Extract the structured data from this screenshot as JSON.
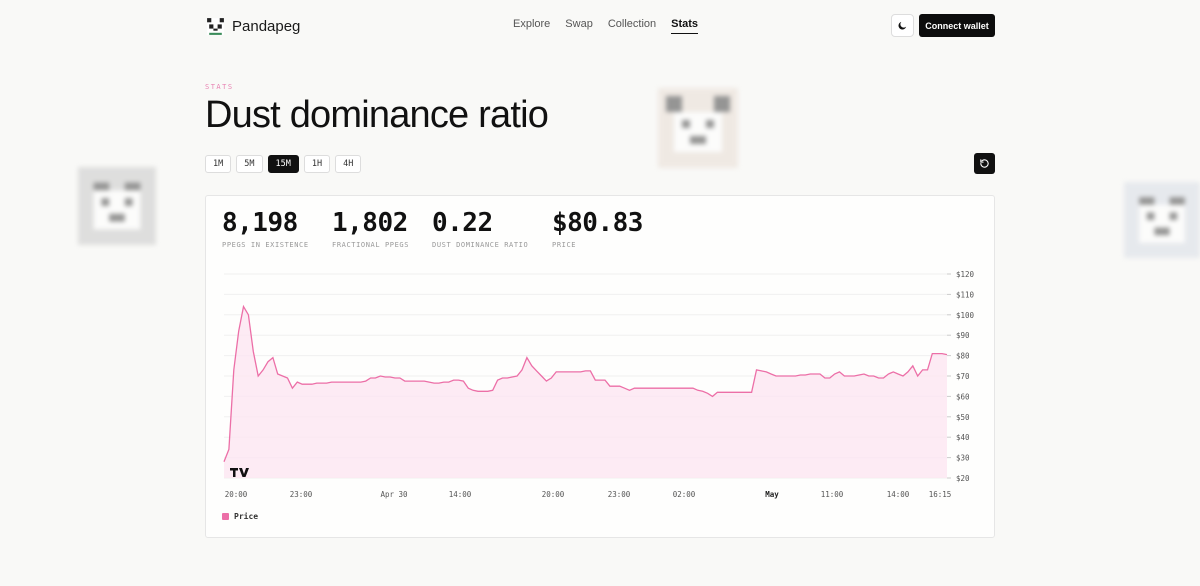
{
  "header": {
    "brand": "Pandapeg",
    "nav": [
      {
        "label": "Explore",
        "active": false
      },
      {
        "label": "Swap",
        "active": false
      },
      {
        "label": "Collection",
        "active": false
      },
      {
        "label": "Stats",
        "active": true
      }
    ],
    "theme_icon": "moon-icon",
    "connect_label": "Connect wallet"
  },
  "page": {
    "eyebrow": "STATS",
    "title": "Dust dominance ratio"
  },
  "timeframes": [
    {
      "label": "1M",
      "active": false
    },
    {
      "label": "5M",
      "active": false
    },
    {
      "label": "15M",
      "active": true
    },
    {
      "label": "1H",
      "active": false
    },
    {
      "label": "4H",
      "active": false
    }
  ],
  "refresh_icon": "refresh-icon",
  "stats": [
    {
      "value": "8,198",
      "label": "PPEGS IN EXISTENCE"
    },
    {
      "value": "1,802",
      "label": "FRACTIONAL PPEGS"
    },
    {
      "value": "0.22",
      "label": "DUST DOMINANCE RATIO"
    },
    {
      "value": "$80.83",
      "label": "PRICE"
    }
  ],
  "legend": {
    "label": "Price"
  },
  "watermark_icon": "tradingview-logo-icon",
  "colors": {
    "accent_pink": "#ec6fa7",
    "area_fill": "#fde6f1",
    "eyebrow": "#e884b3"
  },
  "chart_data": {
    "type": "area",
    "series": [
      {
        "name": "Price",
        "values": [
          28,
          34,
          73,
          92,
          104,
          100,
          82,
          70,
          73,
          77,
          79,
          71,
          70,
          69,
          64,
          67,
          66,
          66,
          66,
          66.5,
          66.5,
          66.5,
          67,
          67,
          67,
          67,
          67,
          67,
          67,
          67.5,
          69,
          69,
          70,
          69.5,
          69.5,
          69,
          69,
          67.5,
          67.5,
          67.5,
          67.5,
          67.5,
          67,
          66.5,
          66.5,
          67,
          67,
          68,
          68,
          67.5,
          64,
          63,
          62.5,
          62.5,
          62.5,
          63,
          68,
          69,
          69,
          69.5,
          70,
          73,
          79,
          75,
          72.5,
          70,
          67.5,
          69,
          72,
          72,
          72,
          72,
          72,
          72,
          72.5,
          72.5,
          68,
          68,
          68,
          65,
          65,
          65,
          64,
          63,
          64,
          64,
          64,
          64,
          64,
          64,
          64,
          64,
          64,
          64,
          64,
          64,
          64,
          63,
          62.5,
          61.5,
          60,
          62,
          62,
          62,
          62,
          62,
          62,
          62,
          62,
          73,
          72.5,
          72,
          71,
          70,
          70,
          70,
          70,
          70,
          70.5,
          70.5,
          71,
          71,
          71,
          69,
          69,
          71,
          72,
          70,
          70,
          70,
          70.5,
          71,
          70,
          70,
          69,
          69,
          71,
          72,
          71,
          70,
          72,
          75,
          70,
          73,
          73,
          81,
          81,
          81,
          80.5
        ]
      }
    ],
    "x_tick_labels": [
      "20:00",
      "23:00",
      "Apr 30",
      "14:00",
      "20:00",
      "23:00",
      "02:00",
      "May",
      "11:00",
      "14:00",
      "16:15"
    ],
    "y_tick_labels": [
      "$120",
      "$110",
      "$100",
      "$90",
      "$80",
      "$70",
      "$60",
      "$50",
      "$40",
      "$30",
      "$20"
    ],
    "ylim": [
      20,
      120
    ],
    "grid": true,
    "legend_placement": "bottom-left"
  }
}
